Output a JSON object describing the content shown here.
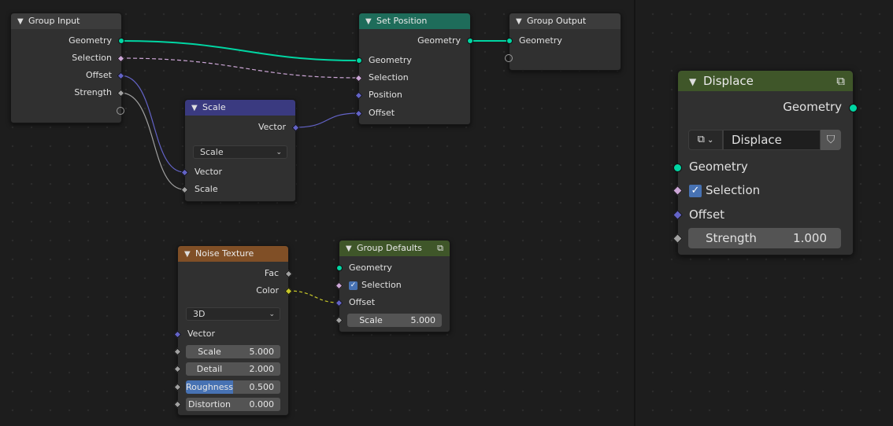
{
  "colors": {
    "group_header": "#3c3c3c",
    "set_position_header": "#1e6c5a",
    "scale_header": "#3a3a80",
    "noise_header": "#804f26",
    "group_defaults_header": "#3f5629",
    "geometry_socket": "#00d6a3",
    "selection_socket": "#cca6d6",
    "vector_socket": "#6363c7",
    "float_socket": "#a1a1a1",
    "color_socket": "#c7c729"
  },
  "nodes": {
    "group_input": {
      "title": "Group Input",
      "outputs": [
        "Geometry",
        "Selection",
        "Offset",
        "Strength"
      ]
    },
    "set_position": {
      "title": "Set Position",
      "output": "Geometry",
      "inputs": [
        "Geometry",
        "Selection",
        "Position",
        "Offset"
      ]
    },
    "group_output": {
      "title": "Group Output",
      "input": "Geometry"
    },
    "scale": {
      "title": "Scale",
      "output": "Vector",
      "mode": "Scale",
      "inputs": [
        "Vector",
        "Scale"
      ]
    },
    "noise_texture": {
      "title": "Noise Texture",
      "outputs": [
        "Fac",
        "Color"
      ],
      "dimensions": "3D",
      "vector_label": "Vector",
      "fields": [
        {
          "label": "Scale",
          "value": "5.000"
        },
        {
          "label": "Detail",
          "value": "2.000"
        },
        {
          "label": "Roughness",
          "value": "0.500",
          "fill_fraction": 0.5
        },
        {
          "label": "Distortion",
          "value": "0.000"
        }
      ]
    },
    "group_defaults": {
      "title": "Group Defaults",
      "inputs": [
        "Geometry",
        "Selection",
        "Offset"
      ],
      "scale_label": "Scale",
      "scale_value": "5.000"
    },
    "displace": {
      "title": "Displace",
      "output": "Geometry",
      "group_name": "Displace",
      "inputs": [
        "Geometry",
        "Selection",
        "Offset"
      ],
      "strength_label": "Strength",
      "strength_value": "1.000"
    }
  }
}
